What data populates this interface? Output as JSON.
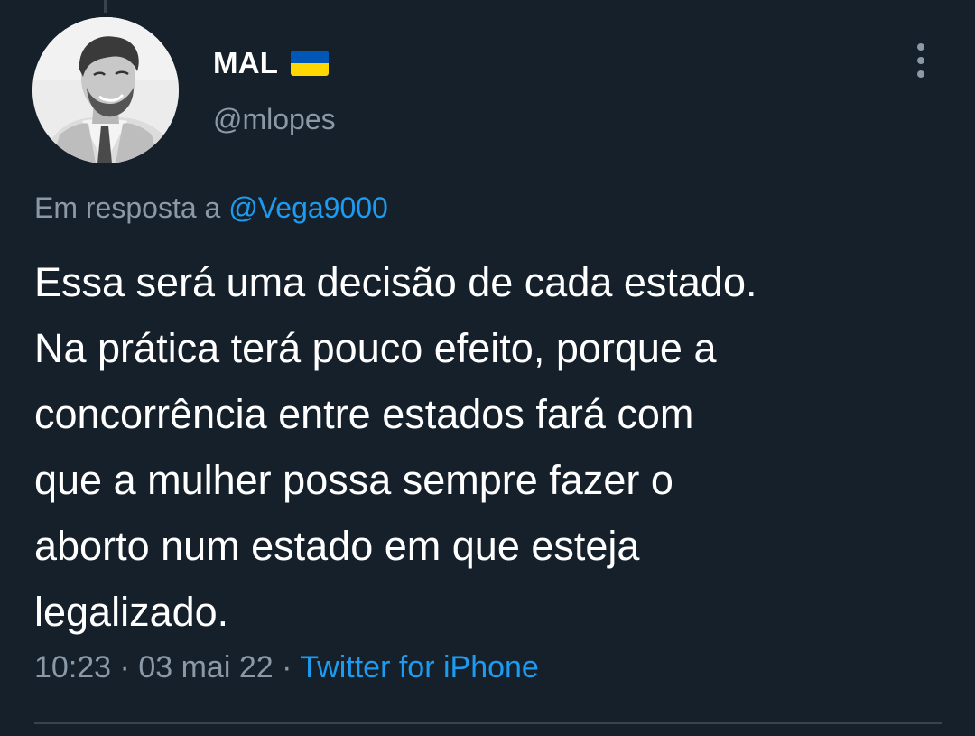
{
  "tweet": {
    "author": {
      "display_name": "MAL",
      "flag_icon": "ukraine-flag-icon",
      "handle": "@mlopes"
    },
    "reply": {
      "prefix": "Em resposta a",
      "mention": "@Vega9000"
    },
    "text_lines": [
      "Essa será uma decisão de cada estado.",
      "Na prática terá pouco efeito, porque a",
      "concorrência entre estados fará com",
      "que a mulher possa sempre fazer o",
      "aborto num estado em que esteja",
      "legalizado."
    ],
    "meta": {
      "time": "10:23",
      "separator": "·",
      "date": "03 mai 22",
      "source": "Twitter for iPhone"
    }
  },
  "colors": {
    "background": "#15202b",
    "text_primary": "#ffffff",
    "text_secondary": "#8b98a5",
    "accent": "#1d9bf0",
    "divider": "#38444d",
    "flag_blue": "#0057b7",
    "flag_yellow": "#ffd700"
  }
}
